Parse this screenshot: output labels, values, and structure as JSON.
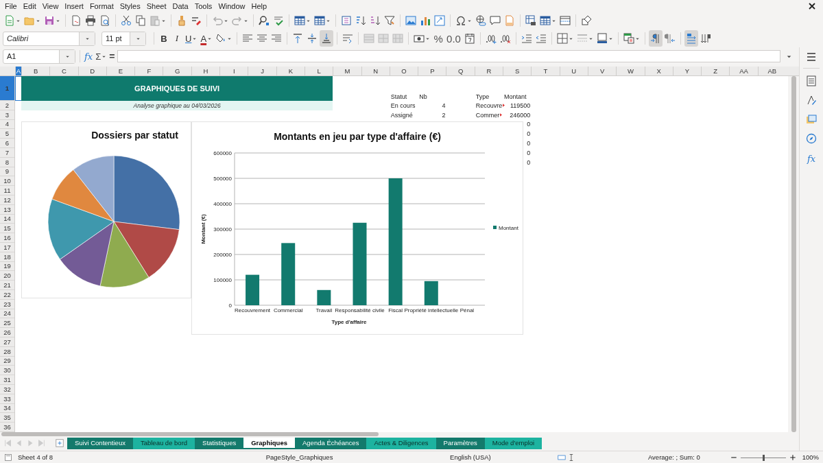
{
  "menu": [
    "File",
    "Edit",
    "View",
    "Insert",
    "Format",
    "Styles",
    "Sheet",
    "Data",
    "Tools",
    "Window",
    "Help"
  ],
  "formatting_toolbar": {
    "font_name": "Calibri",
    "font_size": "11 pt",
    "bold": "B",
    "italic": "I",
    "underline": "U",
    "font_color": "A",
    "percent": "%",
    "number_format": "0.0",
    "vertical_align": [
      {
        "selected": false
      },
      {
        "selected": false
      },
      {
        "selected": true
      }
    ],
    "paragraph_direction": [
      {
        "selected": true
      },
      {
        "selected": false
      }
    ],
    "text_direction": [
      {
        "selected": true
      },
      {
        "selected": false
      }
    ]
  },
  "formula_bar": {
    "name_box": "A1",
    "function_wizard": "fx",
    "sum": "Σ",
    "equals": "="
  },
  "sidebar": {
    "functions": "fx"
  },
  "columns": [
    {
      "label": "A",
      "selected": true
    },
    {
      "label": "B",
      "selected": false
    },
    {
      "label": "C",
      "selected": false
    },
    {
      "label": "D",
      "selected": false
    },
    {
      "label": "E",
      "selected": false
    },
    {
      "label": "F",
      "selected": false
    },
    {
      "label": "G",
      "selected": false
    },
    {
      "label": "H",
      "selected": false
    },
    {
      "label": "I",
      "selected": false
    },
    {
      "label": "J",
      "selected": false
    },
    {
      "label": "K",
      "selected": false
    },
    {
      "label": "L",
      "selected": false
    },
    {
      "label": "M",
      "selected": false
    },
    {
      "label": "N",
      "selected": false
    },
    {
      "label": "O",
      "selected": false
    },
    {
      "label": "P",
      "selected": false
    },
    {
      "label": "Q",
      "selected": false
    },
    {
      "label": "R",
      "selected": false
    },
    {
      "label": "S",
      "selected": false
    },
    {
      "label": "T",
      "selected": false
    },
    {
      "label": "U",
      "selected": false
    },
    {
      "label": "V",
      "selected": false
    },
    {
      "label": "W",
      "selected": false
    },
    {
      "label": "X",
      "selected": false
    },
    {
      "label": "Y",
      "selected": false
    },
    {
      "label": "Z",
      "selected": false
    },
    {
      "label": "AA",
      "selected": false
    },
    {
      "label": "AB",
      "selected": false
    }
  ],
  "rows": [
    {
      "label": "1",
      "selected": true
    },
    {
      "label": "2",
      "selected": false
    },
    {
      "label": "3",
      "selected": false
    },
    {
      "label": "4",
      "selected": false
    },
    {
      "label": "5",
      "selected": false
    },
    {
      "label": "6",
      "selected": false
    },
    {
      "label": "7",
      "selected": false
    },
    {
      "label": "8",
      "selected": false
    },
    {
      "label": "9",
      "selected": false
    },
    {
      "label": "10",
      "selected": false
    },
    {
      "label": "11",
      "selected": false
    },
    {
      "label": "12",
      "selected": false
    },
    {
      "label": "13",
      "selected": false
    },
    {
      "label": "14",
      "selected": false
    },
    {
      "label": "15",
      "selected": false
    },
    {
      "label": "16",
      "selected": false
    },
    {
      "label": "17",
      "selected": false
    },
    {
      "label": "18",
      "selected": false
    },
    {
      "label": "19",
      "selected": false
    },
    {
      "label": "20",
      "selected": false
    },
    {
      "label": "21",
      "selected": false
    },
    {
      "label": "22",
      "selected": false
    },
    {
      "label": "23",
      "selected": false
    },
    {
      "label": "24",
      "selected": false
    },
    {
      "label": "25",
      "selected": false
    },
    {
      "label": "26",
      "selected": false
    },
    {
      "label": "27",
      "selected": false
    },
    {
      "label": "28",
      "selected": false
    },
    {
      "label": "29",
      "selected": false
    },
    {
      "label": "30",
      "selected": false
    },
    {
      "label": "31",
      "selected": false
    },
    {
      "label": "32",
      "selected": false
    },
    {
      "label": "33",
      "selected": false
    },
    {
      "label": "34",
      "selected": false
    },
    {
      "label": "35",
      "selected": false
    },
    {
      "label": "36",
      "selected": false
    }
  ],
  "title_banner": "GRAPHIQUES DE SUIVI",
  "subtitle": "Analyse graphique au 04/03/2026",
  "status_table": {
    "headers": [
      "Statut",
      "Nb"
    ],
    "rows": [
      [
        "En cours",
        "4"
      ],
      [
        "Assigné",
        "2"
      ]
    ]
  },
  "type_table": {
    "headers": [
      "Type",
      "Montant"
    ],
    "rows": [
      {
        "type": "Recouvre",
        "amount": "119500",
        "overflow": true
      },
      {
        "type": "Commer",
        "amount": "246000",
        "overflow": true
      },
      {
        "amount": "0"
      },
      {
        "amount": "0"
      },
      {
        "amount": "0"
      },
      {
        "amount": "0"
      },
      {
        "amount": "0"
      }
    ]
  },
  "pie_chart": {
    "title": "Dossiers par statut"
  },
  "bar_chart": {
    "chart_data": {
      "type": "bar",
      "title": "Montants en jeu par type d'affaire (€)",
      "xlabel": "Type d'affaire",
      "ylabel": "Montant (€)",
      "categories": [
        "Recouvrement",
        "Commercial",
        "Travail",
        "Responsabilité civile",
        "Fiscal",
        "Propriété intellectuelle",
        "Pénal"
      ],
      "series": [
        {
          "name": "Montant",
          "color": "#127a6e",
          "values": [
            120000,
            245000,
            60000,
            325000,
            500000,
            95000,
            0
          ]
        }
      ],
      "grid": true,
      "ylim": [
        0,
        600000
      ],
      "yticks": [
        0,
        100000,
        200000,
        300000,
        400000,
        500000,
        600000
      ]
    }
  },
  "sheet_tabs": [
    {
      "label": "Suivi Contentieux",
      "color": "#137a6c",
      "selected": false
    },
    {
      "label": "Tableau de bord",
      "color": "#1db3a0",
      "selected": false
    },
    {
      "label": "Statistiques",
      "color": "#137a6c",
      "selected": false
    },
    {
      "label": "Graphiques",
      "color": "#137a6c",
      "selected": true
    },
    {
      "label": "Agenda Échéances",
      "color": "#137a6c",
      "selected": false
    },
    {
      "label": "Actes & Diligences",
      "color": "#1db3a0",
      "selected": false
    },
    {
      "label": "Paramètres",
      "color": "#137a6c",
      "selected": false
    },
    {
      "label": "Mode d'emploi",
      "color": "#1db3a0",
      "selected": false
    }
  ],
  "status_bar": {
    "sheet": "Sheet 4 of 8",
    "page_style": "PageStyle_Graphiques",
    "language": "English (USA)",
    "selection_summary": "Average: ; Sum: 0",
    "zoom": "100%",
    "zoom_slider": {
      "level": 0.5
    }
  }
}
